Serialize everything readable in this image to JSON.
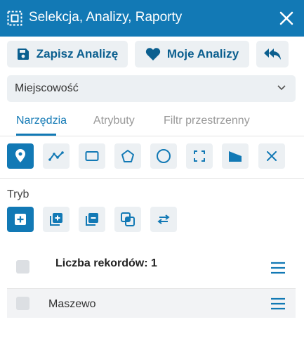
{
  "header": {
    "title": "Selekcja, Analizy, Raporty",
    "icon": "selection-icon",
    "close_icon": "close-icon",
    "bg_color": "#1279b5"
  },
  "actions": {
    "save_label": "Zapisz Analizę",
    "favorites_label": "Moje Analizy",
    "back_icon": "reply-all-icon"
  },
  "layer_select": {
    "value": "Miejscowość"
  },
  "tabs": [
    {
      "label": "Narzędzia",
      "active": true
    },
    {
      "label": "Atrybuty",
      "active": false
    },
    {
      "label": "Filtr przestrzenny",
      "active": false
    }
  ],
  "tools": [
    {
      "icon": "point-marker-icon",
      "active": true
    },
    {
      "icon": "polyline-icon",
      "active": false
    },
    {
      "icon": "rectangle-icon",
      "active": false
    },
    {
      "icon": "polygon-icon",
      "active": false
    },
    {
      "icon": "circle-icon",
      "active": false
    },
    {
      "icon": "extent-icon",
      "active": false
    },
    {
      "icon": "freehand-shape-icon",
      "active": false
    },
    {
      "icon": "clear-icon",
      "active": false
    }
  ],
  "mode": {
    "label": "Tryb",
    "options": [
      {
        "icon": "new-selection-icon",
        "active": true
      },
      {
        "icon": "add-to-selection-icon",
        "active": false
      },
      {
        "icon": "remove-from-selection-icon",
        "active": false
      },
      {
        "icon": "intersect-selection-icon",
        "active": false
      },
      {
        "icon": "swap-selection-icon",
        "active": false
      }
    ]
  },
  "results": {
    "count_label": "Liczba rekordów: 1",
    "items": [
      {
        "name": "Maszewo"
      }
    ]
  }
}
